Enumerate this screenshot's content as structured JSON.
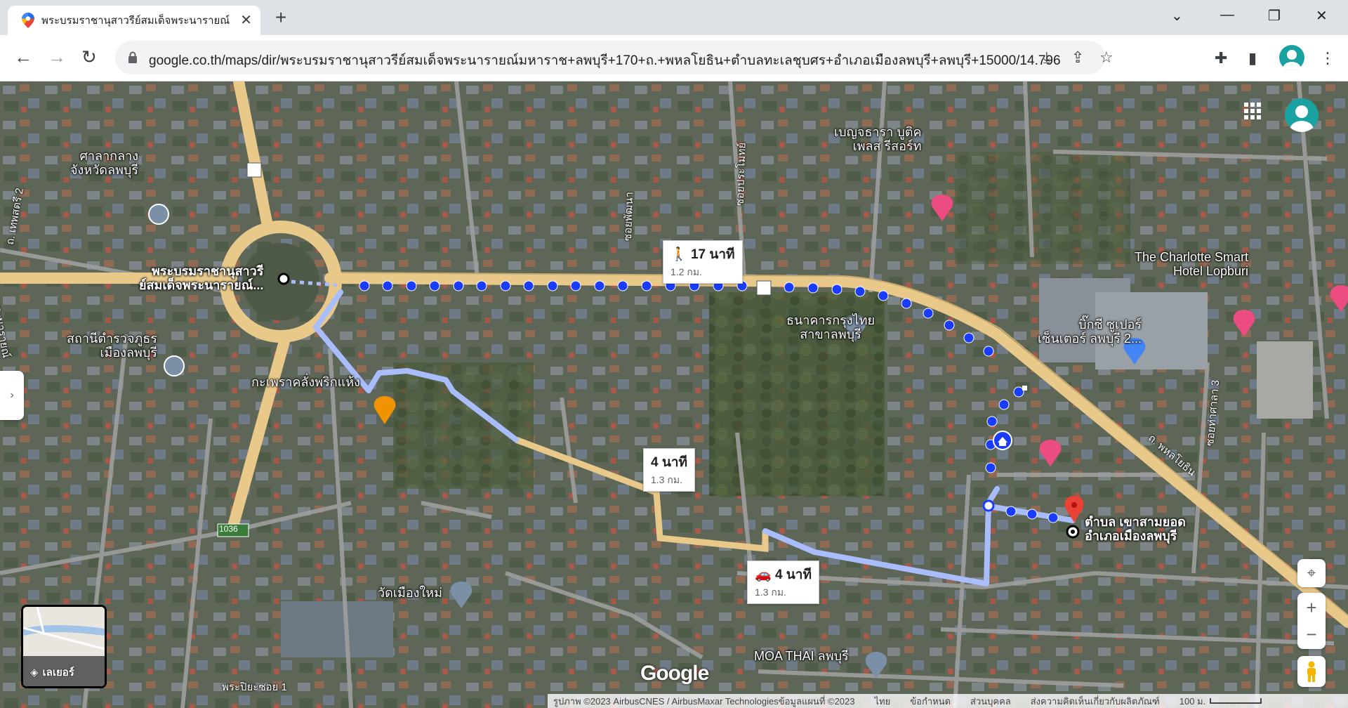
{
  "browser": {
    "tab_title": "พระบรมราชานุสาวรีย์สมเด็จพระนารายณ์",
    "url": "google.co.th/maps/dir/พระบรมราชานุสาวรีย์สมเด็จพระนารายณ์มหาราช+ลพบุรี+170+ถ.+พหลโยธิน+ตำบลทะเลชุบศร+อำเภอเมืองลพบุรี+ลพบุรี+15000/14.796..."
  },
  "map": {
    "places": {
      "origin": "พระบรมราชานุสาวรีย์สมเด็จพระนารายณ์...",
      "origin_line1": "พระบรมราชานุสาวรี",
      "origin_line2": "ย์สมเด็จพระนารายณ์...",
      "destination_line1": "ตำบล เขาสามยอด",
      "destination_line2": "อำเภอเมืองลพบุรี",
      "city_hall_line1": "ศาลากลาง",
      "city_hall_line2": "จังหวัดลพบุรี",
      "police_line1": "สถานีตำรวจภูธร",
      "police_line2": "เมืองลพบุรี",
      "restaurant": "กะเพราคลั่งพริกแห้ง",
      "bank_line1": "ธนาคารกรุงไทย",
      "bank_line2": "สาขาลพบุรี",
      "resort_line1": "เบญจธารา บูติค",
      "resort_line2": "เพลส รีสอร์ท",
      "hotel_line1": "The Charlotte Smart",
      "hotel_line2": "Hotel Lopburi",
      "bigc_line1": "บิ๊กซี ซูเปอร์",
      "bigc_line2": "เซ็นเตอร์ ลพบุรี 2...",
      "temple": "วัดเมืองใหม่",
      "moa": "MOA THAI ลพบุรี"
    },
    "roads": {
      "r1": "ซอยพัฒนา",
      "r2": "ซอยประโมทย์",
      "r3": "ถ. เทพสตรี 2",
      "r4": "พระนารายณ์",
      "r5": "ถ. พหลโยธิน",
      "r6": "ซอยท่าศาลา 3",
      "r7": "พระปิยะซอย 1",
      "route_shield": "1036"
    },
    "routes": {
      "walk_time": "17 นาที",
      "walk_dist": "1.2 กม.",
      "route2_time": "4 นาที",
      "route2_dist": "1.3 กม.",
      "drive_time": "4 นาที",
      "drive_dist": "1.3 กม."
    },
    "layers_label": "เลเยอร์",
    "google_logo": "Google",
    "attribution": {
      "imagery": "รูปภาพ ©2023 AirbusCNES / AirbusMaxar Technologiesข้อมูลแผนที่ ©2023",
      "lang": "ไทย",
      "terms": "ข้อกำหนด",
      "privacy": "ส่วนบุคคล",
      "feedback": "ส่งความคิดเห็นเกี่ยวกับผลิตภัณฑ์",
      "scale": "100 ม."
    }
  },
  "colors": {
    "walk_dots": "#1a3cff",
    "alt_route": "#a9bdfd",
    "road": "#e8c98a",
    "satellite": "#5f6a5a"
  }
}
